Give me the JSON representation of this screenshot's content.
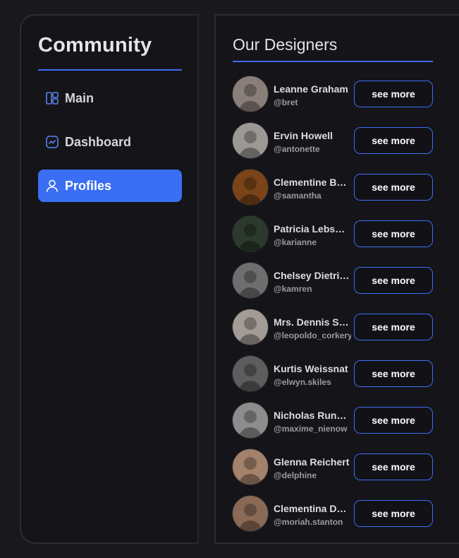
{
  "sidebar": {
    "title": "Community",
    "accent": "#3e6ef5",
    "items": [
      {
        "label": "Main",
        "icon": "layout-icon",
        "active": false
      },
      {
        "label": "Dashboard",
        "icon": "chart-icon",
        "active": false
      },
      {
        "label": "Profiles",
        "icon": "user-icon",
        "active": true
      }
    ]
  },
  "panel": {
    "title": "Our Designers",
    "button_label": "see more",
    "designers": [
      {
        "name": "Leanne Graham",
        "handle": "@bret",
        "avatar_color": "#8a7f78"
      },
      {
        "name": "Ervin Howell",
        "handle": "@antonette",
        "avatar_color": "#9c9995"
      },
      {
        "name": "Clementine Bauch",
        "handle": "@samantha",
        "avatar_color": "#7a4418"
      },
      {
        "name": "Patricia Lebsack",
        "handle": "@karianne",
        "avatar_color": "#2b3a2c"
      },
      {
        "name": "Chelsey Dietrich",
        "handle": "@kamren",
        "avatar_color": "#6e6e6e"
      },
      {
        "name": "Mrs. Dennis Schulist",
        "handle": "@leopoldo_corkery",
        "avatar_color": "#a39c95"
      },
      {
        "name": "Kurtis Weissnat",
        "handle": "@elwyn.skiles",
        "avatar_color": "#5d5d5d"
      },
      {
        "name": "Nicholas Runolfsdottir V",
        "handle": "@maxime_nienow",
        "avatar_color": "#8d8d8d"
      },
      {
        "name": "Glenna Reichert",
        "handle": "@delphine",
        "avatar_color": "#a4816a"
      },
      {
        "name": "Clementina DuBuque",
        "handle": "@moriah.stanton",
        "avatar_color": "#8a6a56"
      }
    ]
  }
}
